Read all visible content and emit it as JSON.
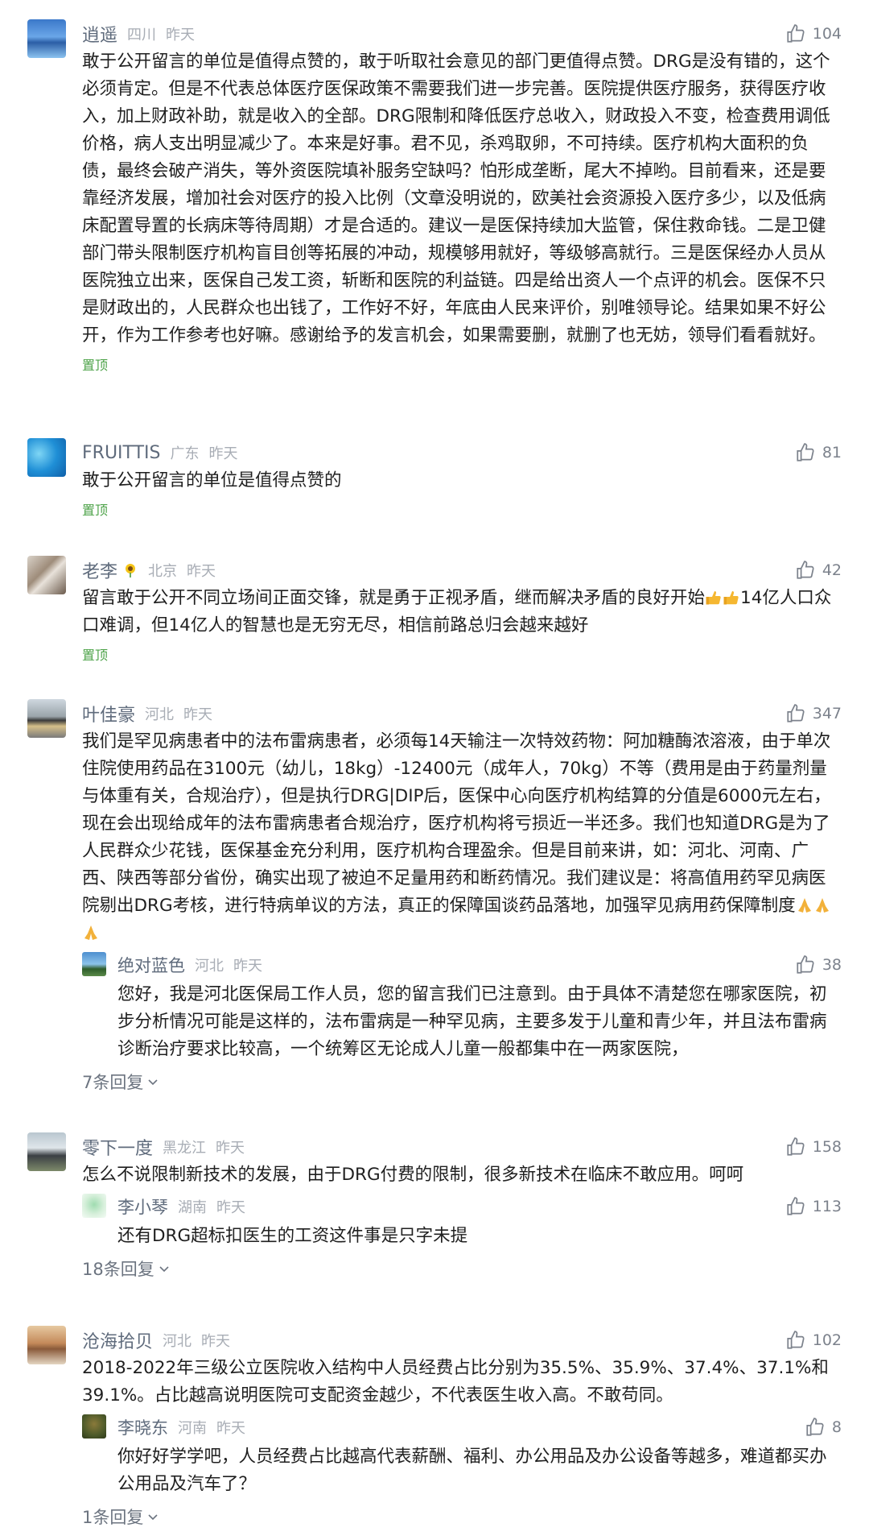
{
  "comments": [
    {
      "name": "逍遥",
      "region": "四川",
      "time": "昨天",
      "likes": "104",
      "text": "敢于公开留言的单位是值得点赞的，敢于听取社会意见的部门更值得点赞。DRG是没有错的，这个必须肯定。但是不代表总体医疗医保政策不需要我们进一步完善。医院提供医疗服务，获得医疗收入，加上财政补助，就是收入的全部。DRG限制和降低医疗总收入，财政投入不变，检查费用调低价格，病人支出明显减少了。本来是好事。君不见，杀鸡取卵，不可持续。医疗机构大面积的负债，最终会破产消失，等外资医院填补服务空缺吗？怕形成垄断，尾大不掉哟。目前看来，还是要靠经济发展，增加社会对医疗的投入比例（文章没明说的，欧美社会资源投入医疗多少，以及低病床配置导置的长病床等待周期）才是合适的。建议一是医保持续加大监管，保住救命钱。二是卫健部门带头限制医疗机构盲目创等拓展的冲动，规模够用就好，等级够高就行。三是医保经办人员从医院独立出来，医保自己发工资，斩断和医院的利益链。四是给出资人一个点评的机会。医保不只是财政出的，人民群众也出钱了，工作好不好，年底由人民来评价，别唯领导论。结果如果不好公开，作为工作参考也好嘛。感谢给予的发言机会，如果需要删，就删了也无妨，领导们看看就好。",
      "pin": "置顶"
    },
    {
      "name": "FRUITTIS",
      "region": "广东",
      "time": "昨天",
      "likes": "81",
      "text": "敢于公开留言的单位是值得点赞的",
      "pin": "置顶"
    },
    {
      "name": "老李",
      "region": "北京",
      "time": "昨天",
      "likes": "42",
      "text_a": "留言敢于公开不同立场间正面交锋，就是勇于正视矛盾，继而解决矛盾的良好开始",
      "text_b": "14亿人口众口难调，但14亿人的智慧也是无穷无尽，相信前路总归会越来越好",
      "pin": "置顶"
    },
    {
      "name": "叶佳豪",
      "region": "河北",
      "time": "昨天",
      "likes": "347",
      "text": "我们是罕见病患者中的法布雷病患者，必须每14天输注一次特效药物：阿加糖酶浓溶液，由于单次住院使用药品在3100元（幼儿，18kg）-12400元（成年人，70kg）不等（费用是由于药量剂量与体重有关，合规治疗），但是执行DRG|DIP后，医保中心向医疗机构结算的分值是6000元左右，现在会出现给成年的法布雷病患者合规治疗，医疗机构将亏损近一半还多。我们也知道DRG是为了人民群众少花钱，医保基金充分利用，医疗机构合理盈余。但是目前来讲，如：河北、河南、广西、陕西等部分省份，确实出现了被迫不足量用药和断药情况。我们建议是：将高值用药罕见病医院剔出DRG考核，进行特病单议的方法，真正的保障国谈药品落地，加强罕见病用药保障制度",
      "reply": {
        "name": "绝对蓝色",
        "region": "河北",
        "time": "昨天",
        "likes": "38",
        "text": "您好，我是河北医保局工作人员，您的留言我们已注意到。由于具体不清楚您在哪家医院，初步分析情况可能是这样的，法布雷病是一种罕见病，主要多发于儿童和青少年，并且法布雷病诊断治疗要求比较高，一个统筹区无论成人儿童一般都集中在一两家医院，"
      },
      "more": "7条回复"
    },
    {
      "name": "零下一度",
      "region": "黑龙江",
      "time": "昨天",
      "likes": "158",
      "text": "怎么不说限制新技术的发展，由于DRG付费的限制，很多新技术在临床不敢应用。呵呵",
      "reply": {
        "name": "李小琴",
        "region": "湖南",
        "time": "昨天",
        "likes": "113",
        "text": "还有DRG超标扣医生的工资这件事是只字未提"
      },
      "more": "18条回复"
    },
    {
      "name": "沧海拾贝",
      "region": "河北",
      "time": "昨天",
      "likes": "102",
      "text": "2018-2022年三级公立医院收入结构中人员经费占比分别为35.5%、35.9%、37.4%、37.1%和39.1%。占比越高说明医院可支配资金越少，不代表医生收入高。不敢苟同。",
      "reply": {
        "name": "李晓东",
        "region": "河南",
        "time": "昨天",
        "likes": "8",
        "text": "你好好学学吧，人员经费占比越高代表薪酬、福利、办公用品及办公设备等越多，难道都买办公用品及汽车了？"
      },
      "more": "1条回复"
    }
  ],
  "icons": {
    "like": "thumbs-up-icon",
    "more": "chevron-down-icon"
  },
  "colors": {
    "pin": "#4ea34a",
    "name": "#5f6b7c",
    "meta": "#a8adb5",
    "text": "#1f1f1f"
  }
}
